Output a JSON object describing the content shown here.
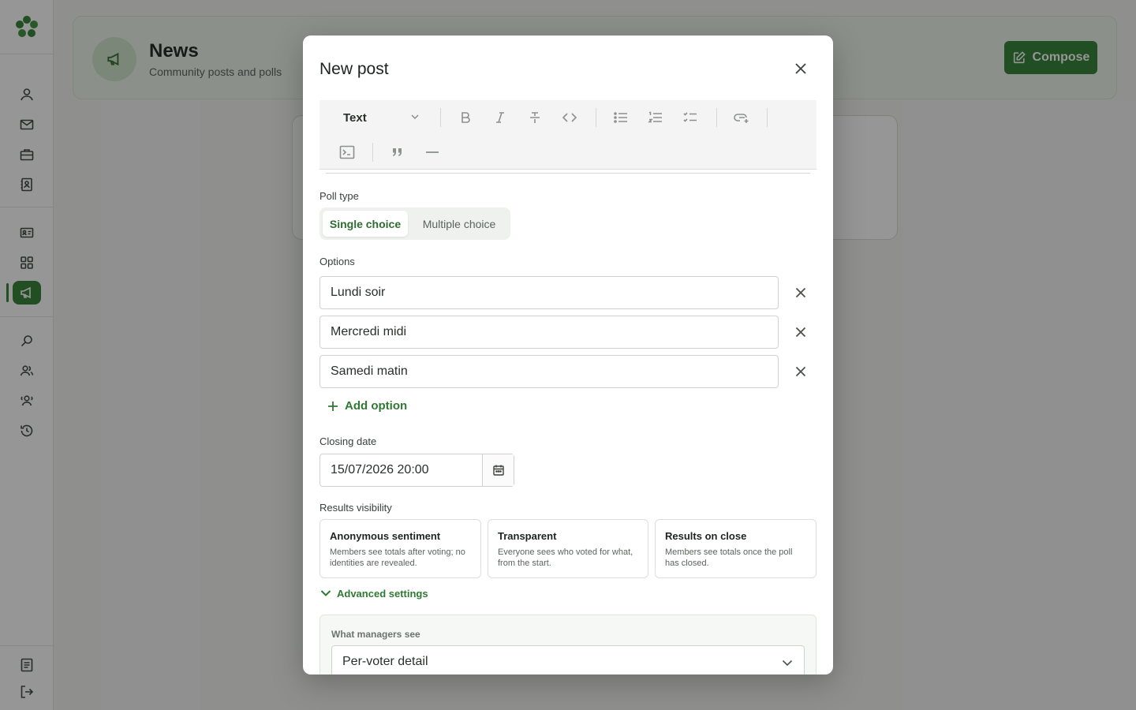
{
  "header": {
    "title": "News",
    "subtitle": "Community posts and polls",
    "compose_label": "Compose"
  },
  "sidebar": {
    "items": [
      "user-icon",
      "mail-icon",
      "briefcase-icon",
      "contact-icon",
      "id-card-icon",
      "grid-icon",
      "megaphone-icon",
      "search-icon",
      "group-icon",
      "team-icon",
      "history-icon"
    ],
    "footer": [
      "document-icon",
      "logout-icon"
    ],
    "active": "megaphone-icon"
  },
  "modal": {
    "title": "New post",
    "toolbar": {
      "block_type": "Text"
    },
    "poll_type": {
      "label": "Poll type",
      "options": [
        "Single choice",
        "Multiple choice"
      ],
      "selected": "Single choice"
    },
    "options": {
      "label": "Options",
      "items": [
        "Lundi soir",
        "Mercredi midi",
        "Samedi matin"
      ],
      "add_label": "Add option"
    },
    "closing_date": {
      "label": "Closing date",
      "value": "15/07/2026 20:00"
    },
    "results_visibility": {
      "label": "Results visibility",
      "cards": [
        {
          "title": "Anonymous sentiment",
          "desc": "Members see totals after voting; no identities are revealed."
        },
        {
          "title": "Transparent",
          "desc": "Everyone sees who voted for what, from the start."
        },
        {
          "title": "Results on close",
          "desc": "Members see totals once the poll has closed."
        }
      ]
    },
    "advanced": {
      "toggle_label": "Advanced settings",
      "managers_label": "What managers see",
      "managers_value": "Per-voter detail"
    }
  },
  "colors": {
    "accent": "#2f7d32",
    "accent_light": "#eef5ec"
  }
}
